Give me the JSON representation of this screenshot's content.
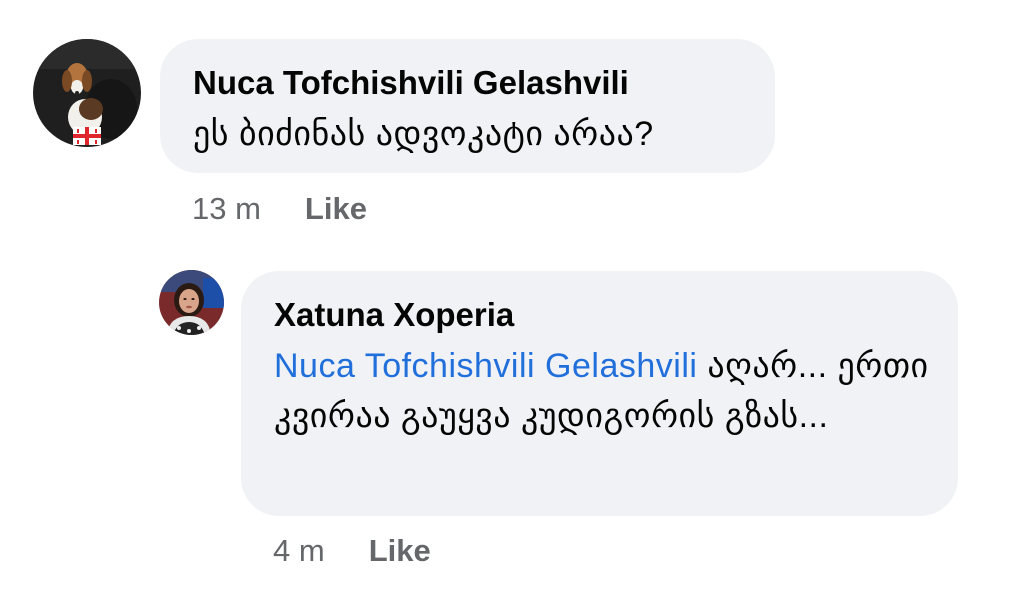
{
  "comments": [
    {
      "author": "Nuca Tofchishvili Gelashvili",
      "text": "ეს ბიძინას ადვოკატი არაა?",
      "time": "13 m",
      "like_label": "Like"
    }
  ],
  "replies": [
    {
      "author": "Xatuna Xoperia",
      "mention": "Nuca Tofchishvili Gelashvili",
      "text": " აღარ... ერთი კვირაა გაუყვა კუდიგორის გზას...",
      "time": "4 m",
      "like_label": "Like"
    }
  ],
  "colors": {
    "bubble_bg": "#f0f2f5",
    "mention_link": "#216fdb",
    "meta_text": "#65676b",
    "primary_text": "#050505"
  },
  "icons": {
    "avatar_1": "beagle-dog-avatar-with-georgian-flag",
    "avatar_2": "woman-portrait-avatar"
  }
}
